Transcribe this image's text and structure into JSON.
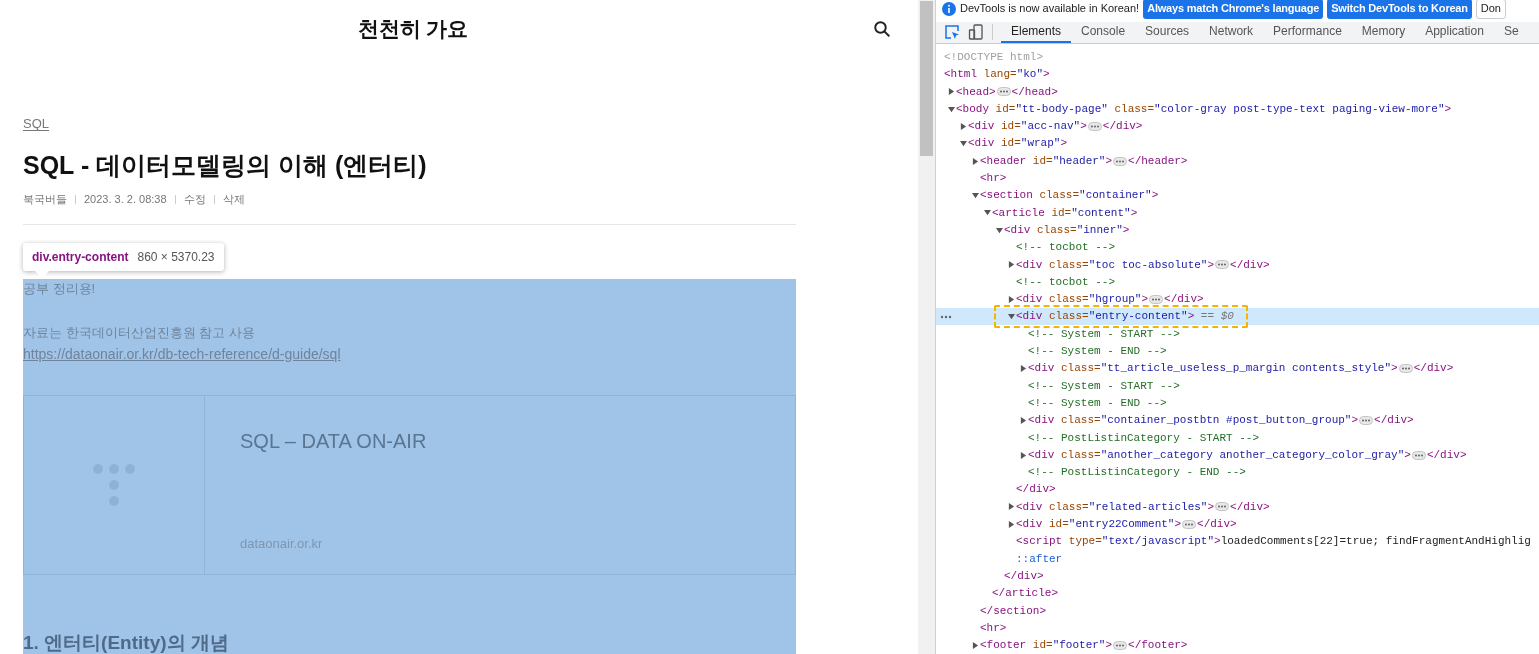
{
  "blog": {
    "title": "천천히 가요"
  },
  "post": {
    "category": "SQL",
    "title": "SQL - 데이터모델링의 이해 (엔터티)",
    "author": "북국버들",
    "date": "2023. 3. 2. 08:38",
    "actions": [
      "수정",
      "삭제"
    ]
  },
  "inspect_tooltip": {
    "selector": "div.entry-content",
    "size": "860 × 5370.23"
  },
  "content": {
    "paragraphs": [
      "공부 정리용!",
      "자료는 한국데이터산업진흥원 참고 사용"
    ],
    "link": "https://dataonair.or.kr/db-tech-reference/d-guide/sql",
    "link_card": {
      "title": "SQL – DATA ON-AIR",
      "domain": "dataonair.or.kr"
    },
    "heading": "1. 엔터티(Entity)의 개념"
  },
  "devtools": {
    "infobar": {
      "message": "DevTools is now available in Korean!",
      "buttons": [
        "Always match Chrome's language",
        "Switch DevTools to Korean"
      ],
      "dismiss": "Don"
    },
    "tabs": [
      {
        "label": "Elements",
        "selected": true
      },
      {
        "label": "Console",
        "selected": false
      },
      {
        "label": "Sources",
        "selected": false
      },
      {
        "label": "Network",
        "selected": false
      },
      {
        "label": "Performance",
        "selected": false
      },
      {
        "label": "Memory",
        "selected": false
      },
      {
        "label": "Application",
        "selected": false
      },
      {
        "label": "Se",
        "selected": false
      }
    ],
    "tree": [
      {
        "selected": false,
        "tokens": [
          {
            "kind": "doctype",
            "text": "<!DOCTYPE html>"
          }
        ]
      },
      {
        "selected": false,
        "tokens": [
          {
            "kind": "tag",
            "text": "<html"
          },
          {
            "kind": "attr",
            "text": " lang="
          },
          {
            "kind": "value",
            "text": "\"ko\""
          },
          {
            "kind": "tag",
            "text": ">"
          }
        ],
        "children": [
          {
            "selected": false,
            "expanded": false,
            "tokens": [
              {
                "kind": "tag",
                "text": "<head>"
              }
            ],
            "close": [
              {
                "kind": "tag",
                "text": "</head>"
              }
            ]
          },
          {
            "selected": false,
            "expanded": true,
            "tokens": [
              {
                "kind": "tag",
                "text": "<body"
              },
              {
                "kind": "attr",
                "text": " id="
              },
              {
                "kind": "value",
                "text": "\"tt-body-page\""
              },
              {
                "kind": "attr",
                "text": " class="
              },
              {
                "kind": "value",
                "text": "\"color-gray post-type-text paging-view-more\""
              },
              {
                "kind": "tag",
                "text": ">"
              }
            ],
            "children": [
              {
                "selected": false,
                "expanded": false,
                "tokens": [
                  {
                    "kind": "tag",
                    "text": "<div"
                  },
                  {
                    "kind": "attr",
                    "text": " id="
                  },
                  {
                    "kind": "value",
                    "text": "\"acc-nav\""
                  },
                  {
                    "kind": "tag",
                    "text": ">"
                  }
                ],
                "close": [
                  {
                    "kind": "tag",
                    "text": "</div>"
                  }
                ]
              },
              {
                "selected": false,
                "expanded": true,
                "tokens": [
                  {
                    "kind": "tag",
                    "text": "<div"
                  },
                  {
                    "kind": "attr",
                    "text": " id="
                  },
                  {
                    "kind": "value",
                    "text": "\"wrap\""
                  },
                  {
                    "kind": "tag",
                    "text": ">"
                  }
                ],
                "children": [
                  {
                    "selected": false,
                    "expanded": false,
                    "tokens": [
                      {
                        "kind": "tag",
                        "text": "<header"
                      },
                      {
                        "kind": "attr",
                        "text": " id="
                      },
                      {
                        "kind": "value",
                        "text": "\"header\""
                      },
                      {
                        "kind": "tag",
                        "text": ">"
                      }
                    ],
                    "close": [
                      {
                        "kind": "tag",
                        "text": "</header>"
                      }
                    ]
                  },
                  {
                    "selected": false,
                    "tokens": [
                      {
                        "kind": "tag",
                        "text": "<hr>"
                      }
                    ]
                  },
                  {
                    "selected": false,
                    "expanded": true,
                    "tokens": [
                      {
                        "kind": "tag",
                        "text": "<section"
                      },
                      {
                        "kind": "attr",
                        "text": " class="
                      },
                      {
                        "kind": "value",
                        "text": "\"container\""
                      },
                      {
                        "kind": "tag",
                        "text": ">"
                      }
                    ],
                    "children": [
                      {
                        "selected": false,
                        "expanded": true,
                        "tokens": [
                          {
                            "kind": "tag",
                            "text": "<article"
                          },
                          {
                            "kind": "attr",
                            "text": " id="
                          },
                          {
                            "kind": "value",
                            "text": "\"content\""
                          },
                          {
                            "kind": "tag",
                            "text": ">"
                          }
                        ],
                        "children": [
                          {
                            "selected": false,
                            "expanded": true,
                            "tokens": [
                              {
                                "kind": "tag",
                                "text": "<div"
                              },
                              {
                                "kind": "attr",
                                "text": " class="
                              },
                              {
                                "kind": "value",
                                "text": "\"inner\""
                              },
                              {
                                "kind": "tag",
                                "text": ">"
                              }
                            ],
                            "children": [
                              {
                                "selected": false,
                                "tokens": [
                                  {
                                    "kind": "comment",
                                    "text": "<!-- tocbot -->"
                                  }
                                ]
                              },
                              {
                                "selected": false,
                                "expanded": false,
                                "tokens": [
                                  {
                                    "kind": "tag",
                                    "text": "<div"
                                  },
                                  {
                                    "kind": "attr",
                                    "text": " class="
                                  },
                                  {
                                    "kind": "value",
                                    "text": "\"toc toc-absolute\""
                                  },
                                  {
                                    "kind": "tag",
                                    "text": ">"
                                  }
                                ],
                                "close": [
                                  {
                                    "kind": "tag",
                                    "text": "</div>"
                                  }
                                ]
                              },
                              {
                                "selected": false,
                                "tokens": [
                                  {
                                    "kind": "comment",
                                    "text": "<!-- tocbot -->"
                                  }
                                ]
                              },
                              {
                                "selected": false,
                                "expanded": false,
                                "tokens": [
                                  {
                                    "kind": "tag",
                                    "text": "<div"
                                  },
                                  {
                                    "kind": "attr",
                                    "text": " class="
                                  },
                                  {
                                    "kind": "value",
                                    "text": "\"hgroup\""
                                  },
                                  {
                                    "kind": "tag",
                                    "text": ">"
                                  }
                                ],
                                "close": [
                                  {
                                    "kind": "tag",
                                    "text": "</div>"
                                  }
                                ]
                              },
                              {
                                "selected": true,
                                "expanded": true,
                                "tokens": [
                                  {
                                    "kind": "tag",
                                    "text": "<div"
                                  },
                                  {
                                    "kind": "attr",
                                    "text": " class="
                                  },
                                  {
                                    "kind": "value",
                                    "text": "\"entry-content\""
                                  },
                                  {
                                    "kind": "tag",
                                    "text": ">"
                                  },
                                  {
                                    "kind": "ref",
                                    "text": " == $0"
                                  }
                                ],
                                "children": [
                                  {
                                    "selected": false,
                                    "tokens": [
                                      {
                                        "kind": "comment",
                                        "text": "<!-- System - START -->"
                                      }
                                    ]
                                  },
                                  {
                                    "selected": false,
                                    "tokens": [
                                      {
                                        "kind": "comment",
                                        "text": "<!-- System - END -->"
                                      }
                                    ]
                                  },
                                  {
                                    "selected": false,
                                    "expanded": false,
                                    "tokens": [
                                      {
                                        "kind": "tag",
                                        "text": "<div"
                                      },
                                      {
                                        "kind": "attr",
                                        "text": " class="
                                      },
                                      {
                                        "kind": "value",
                                        "text": "\"tt_article_useless_p_margin contents_style\""
                                      },
                                      {
                                        "kind": "tag",
                                        "text": ">"
                                      }
                                    ],
                                    "close": [
                                      {
                                        "kind": "tag",
                                        "text": "</div>"
                                      }
                                    ]
                                  },
                                  {
                                    "selected": false,
                                    "tokens": [
                                      {
                                        "kind": "comment",
                                        "text": "<!-- System - START -->"
                                      }
                                    ]
                                  },
                                  {
                                    "selected": false,
                                    "tokens": [
                                      {
                                        "kind": "comment",
                                        "text": "<!-- System - END -->"
                                      }
                                    ]
                                  },
                                  {
                                    "selected": false,
                                    "expanded": false,
                                    "tokens": [
                                      {
                                        "kind": "tag",
                                        "text": "<div"
                                      },
                                      {
                                        "kind": "attr",
                                        "text": " class="
                                      },
                                      {
                                        "kind": "value",
                                        "text": "\"container_postbtn #post_button_group\""
                                      },
                                      {
                                        "kind": "tag",
                                        "text": ">"
                                      }
                                    ],
                                    "close": [
                                      {
                                        "kind": "tag",
                                        "text": "</div>"
                                      }
                                    ]
                                  },
                                  {
                                    "selected": false,
                                    "tokens": [
                                      {
                                        "kind": "comment",
                                        "text": "<!-- PostListinCategory - START -->"
                                      }
                                    ]
                                  },
                                  {
                                    "selected": false,
                                    "expanded": false,
                                    "tokens": [
                                      {
                                        "kind": "tag",
                                        "text": "<div"
                                      },
                                      {
                                        "kind": "attr",
                                        "text": " class="
                                      },
                                      {
                                        "kind": "value",
                                        "text": "\"another_category another_category_color_gray\""
                                      },
                                      {
                                        "kind": "tag",
                                        "text": ">"
                                      }
                                    ],
                                    "close": [
                                      {
                                        "kind": "tag",
                                        "text": "</div>"
                                      }
                                    ]
                                  },
                                  {
                                    "selected": false,
                                    "tokens": [
                                      {
                                        "kind": "comment",
                                        "text": "<!-- PostListinCategory - END -->"
                                      }
                                    ]
                                  }
                                ],
                                "close": [
                                  {
                                    "kind": "tag",
                                    "text": "</div>"
                                  }
                                ]
                              },
                              {
                                "selected": false,
                                "expanded": false,
                                "tokens": [
                                  {
                                    "kind": "tag",
                                    "text": "<div"
                                  },
                                  {
                                    "kind": "attr",
                                    "text": " class="
                                  },
                                  {
                                    "kind": "value",
                                    "text": "\"related-articles\""
                                  },
                                  {
                                    "kind": "tag",
                                    "text": ">"
                                  }
                                ],
                                "close": [
                                  {
                                    "kind": "tag",
                                    "text": "</div>"
                                  }
                                ]
                              },
                              {
                                "selected": false,
                                "expanded": false,
                                "tokens": [
                                  {
                                    "kind": "tag",
                                    "text": "<div"
                                  },
                                  {
                                    "kind": "attr",
                                    "text": " id="
                                  },
                                  {
                                    "kind": "value",
                                    "text": "\"entry22Comment\""
                                  },
                                  {
                                    "kind": "tag",
                                    "text": ">"
                                  }
                                ],
                                "close": [
                                  {
                                    "kind": "tag",
                                    "text": "</div>"
                                  }
                                ]
                              },
                              {
                                "selected": false,
                                "tokens": [
                                  {
                                    "kind": "tag",
                                    "text": "<script"
                                  },
                                  {
                                    "kind": "attr",
                                    "text": " type="
                                  },
                                  {
                                    "kind": "value",
                                    "text": "\"text/javascript\""
                                  },
                                  {
                                    "kind": "tag",
                                    "text": ">"
                                  },
                                  {
                                    "kind": "text",
                                    "text": "loadedComments[22]=true; findFragmentAndHighlig"
                                  }
                                ]
                              },
                              {
                                "selected": false,
                                "tokens": [
                                  {
                                    "kind": "pseudo",
                                    "text": "::after"
                                  }
                                ]
                              }
                            ],
                            "close": [
                              {
                                "kind": "tag",
                                "text": "</div>"
                              }
                            ]
                          }
                        ],
                        "close": [
                          {
                            "kind": "tag",
                            "text": "</article>"
                          }
                        ]
                      }
                    ],
                    "close": [
                      {
                        "kind": "tag",
                        "text": "</section>"
                      }
                    ]
                  },
                  {
                    "selected": false,
                    "tokens": [
                      {
                        "kind": "tag",
                        "text": "<hr>"
                      }
                    ]
                  },
                  {
                    "selected": false,
                    "expanded": false,
                    "tokens": [
                      {
                        "kind": "tag",
                        "text": "<footer"
                      },
                      {
                        "kind": "attr",
                        "text": " id="
                      },
                      {
                        "kind": "value",
                        "text": "\"footer\""
                      },
                      {
                        "kind": "tag",
                        "text": ">"
                      }
                    ],
                    "close": [
                      {
                        "kind": "tag",
                        "text": "</footer>"
                      }
                    ]
                  }
                ]
              }
            ]
          }
        ]
      }
    ]
  }
}
